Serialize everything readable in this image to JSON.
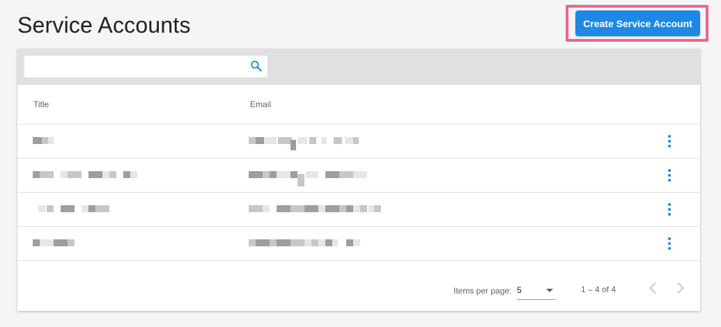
{
  "page": {
    "title": "Service Accounts"
  },
  "actions": {
    "create_label": "Create Service Account"
  },
  "search": {
    "value": "",
    "placeholder": "",
    "icon": "search-icon"
  },
  "table": {
    "columns": {
      "title": "Title",
      "email": "Email"
    },
    "rows": [
      {
        "title": "",
        "email": "",
        "menu_icon": "more-vertical-icon"
      },
      {
        "title": "",
        "email": "",
        "menu_icon": "more-vertical-icon"
      },
      {
        "title": "",
        "email": "",
        "menu_icon": "more-vertical-icon"
      },
      {
        "title": "",
        "email": "",
        "menu_icon": "more-vertical-icon"
      }
    ]
  },
  "pagination": {
    "items_per_page_label": "Items per page:",
    "page_size": "5",
    "range_label": "1 – 4 of 4",
    "previous_icon": "chevron-left-icon",
    "next_icon": "chevron-right-icon"
  },
  "colors": {
    "accent": "#1e88e5",
    "highlight": "#f06292",
    "background": "#f5f5f5",
    "toolbar": "#e0e0e0"
  }
}
